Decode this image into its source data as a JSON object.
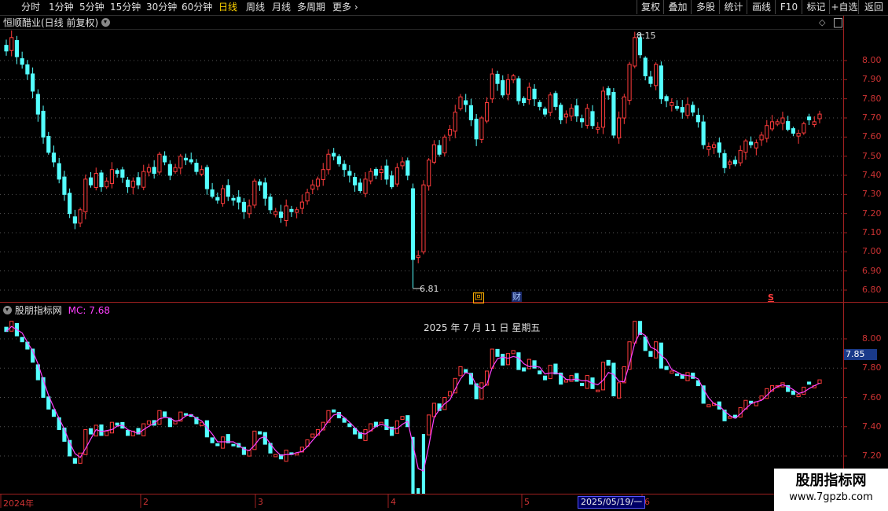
{
  "toolbar": {
    "periods": [
      "分时",
      "1分钟",
      "5分钟",
      "15分钟",
      "30分钟",
      "60分钟",
      "日线",
      "周线",
      "月线",
      "多周期",
      "更多"
    ],
    "active_period": "日线",
    "buttons": [
      "复权",
      "叠加",
      "多股",
      "统计",
      "画线",
      "F10",
      "标记",
      "+自选",
      "返回"
    ]
  },
  "main_panel": {
    "title": "恒顺醋业(日线 前复权)",
    "high_label": "8.15",
    "low_label": "6.81",
    "price_ticks": [
      "8.00",
      "7.90",
      "7.80",
      "7.70",
      "7.60",
      "7.50",
      "7.40",
      "7.30",
      "7.20",
      "7.10",
      "7.00",
      "6.90",
      "6.80"
    ],
    "icon_hui": "回",
    "icon_cai": "财",
    "icon_s": "S"
  },
  "indicator_panel": {
    "title": "股朋指标网",
    "mc_label": "MC: 7.68",
    "date_overlay": "2025 年 7 月 11 日 星期五",
    "ticks": [
      "8.00",
      "7.80",
      "7.60",
      "7.40",
      "7.20"
    ],
    "current_value": "7.85"
  },
  "date_axis": {
    "labels": [
      "2024年",
      "2",
      "3",
      "4",
      "5",
      "6"
    ],
    "cursor_date": "2025/05/19/一"
  },
  "watermark": {
    "name": "股朋指标网",
    "url": "www.7gpzb.com"
  },
  "colors": {
    "up": "#ff3c3c",
    "down": "#54ffff",
    "ma": "#ff40ff",
    "axis": "#cc3333"
  },
  "chart_data": {
    "type": "candlestick",
    "ylim": [
      6.77,
      8.22
    ],
    "closes": [
      8.05,
      8.12,
      8.02,
      7.98,
      7.93,
      7.84,
      7.72,
      7.6,
      7.52,
      7.47,
      7.38,
      7.3,
      7.2,
      7.15,
      7.22,
      7.38,
      7.35,
      7.41,
      7.34,
      7.37,
      7.43,
      7.41,
      7.39,
      7.34,
      7.37,
      7.35,
      7.42,
      7.44,
      7.41,
      7.51,
      7.47,
      7.4,
      7.44,
      7.5,
      7.48,
      7.47,
      7.42,
      7.43,
      7.33,
      7.29,
      7.27,
      7.33,
      7.29,
      7.27,
      7.26,
      7.21,
      7.24,
      7.37,
      7.35,
      7.28,
      7.22,
      7.21,
      7.18,
      7.24,
      7.21,
      7.22,
      7.26,
      7.31,
      7.35,
      7.38,
      7.43,
      7.51,
      7.5,
      7.46,
      7.43,
      7.4,
      7.35,
      7.32,
      7.38,
      7.42,
      7.4,
      7.43,
      7.38,
      7.34,
      7.44,
      7.47,
      7.4,
      6.96,
      6.98,
      7.35,
      7.48,
      7.56,
      7.51,
      7.6,
      7.64,
      7.73,
      7.81,
      7.77,
      7.69,
      7.59,
      7.7,
      7.78,
      7.93,
      7.88,
      7.82,
      7.9,
      7.92,
      7.79,
      7.78,
      7.86,
      7.8,
      7.76,
      7.72,
      7.82,
      7.76,
      7.69,
      7.72,
      7.75,
      7.71,
      7.68,
      7.75,
      7.66,
      7.65,
      7.84,
      7.82,
      7.61,
      7.7,
      7.81,
      7.98,
      8.12,
      8.03,
      7.92,
      7.88,
      7.98,
      7.8,
      7.79,
      7.78,
      7.75,
      7.73,
      7.77,
      7.73,
      7.68,
      7.56,
      7.55,
      7.56,
      7.52,
      7.44,
      7.47,
      7.46,
      7.53,
      7.58,
      7.56,
      7.57,
      7.61,
      7.66,
      7.68,
      7.68,
      7.7,
      7.64,
      7.62,
      7.62,
      7.67,
      7.69,
      7.68,
      7.72
    ],
    "ma_label": "MC",
    "ma_last": 7.68
  }
}
